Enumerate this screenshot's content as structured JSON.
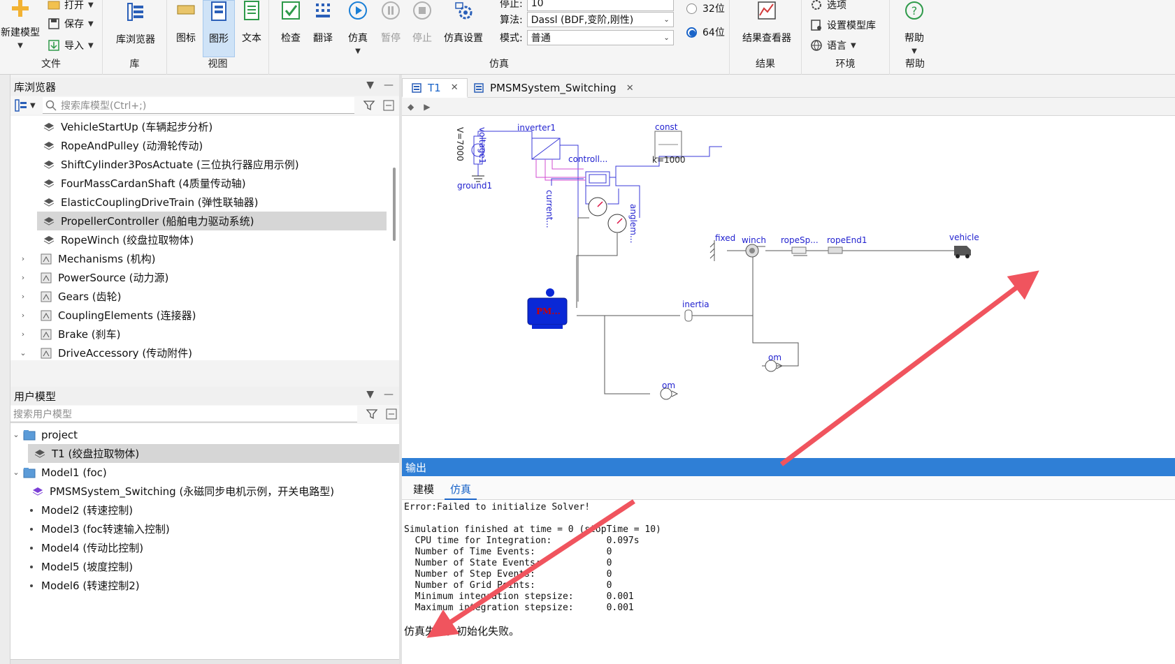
{
  "ribbon": {
    "file_group": {
      "new_model": "新建模型",
      "open": "打开",
      "save": "保存",
      "import": "导入",
      "label": "文件"
    },
    "lib_group": {
      "lib_browser": "库浏览器",
      "label": "库"
    },
    "view_group": {
      "icon": "图标",
      "diagram": "图形",
      "text": "文本",
      "label": "视图"
    },
    "sim_group": {
      "check": "检查",
      "translate": "翻译",
      "simulate": "仿真",
      "pause": "暂停",
      "stop": "停止",
      "sim_settings": "仿真设置",
      "stop_time_label": "停止:",
      "stop_time_value": "10",
      "algorithm_label": "算法:",
      "algorithm_value": "Dassl (BDF,变阶,刚性)",
      "mode_label": "模式:",
      "mode_value": "普通",
      "bit32": "32位",
      "bit64": "64位",
      "selected_bits": "64位",
      "label": "仿真"
    },
    "result_group": {
      "viewer": "结果查看器",
      "label": "结果"
    },
    "env_group": {
      "options": "选项",
      "set_model_lib": "设置模型库",
      "language": "语言",
      "label": "环境"
    },
    "help_group": {
      "help": "帮助",
      "label": "帮助"
    }
  },
  "lib_panel": {
    "title": "库浏览器",
    "search_placeholder": "搜索库模型(Ctrl+;)",
    "items": [
      {
        "label": "VehicleStartUp (车辆起步分析)",
        "type": "model"
      },
      {
        "label": "RopeAndPulley (动滑轮传动)",
        "type": "model"
      },
      {
        "label": "ShiftCylinder3PosActuate (三位执行器应用示例)",
        "type": "model"
      },
      {
        "label": "FourMassCardanShaft (4质量传动轴)",
        "type": "model"
      },
      {
        "label": "ElasticCouplingDriveTrain (弹性联轴器)",
        "type": "model"
      },
      {
        "label": "PropellerController (船舶电力驱动系统)",
        "type": "model",
        "selected": true
      },
      {
        "label": "RopeWinch (绞盘拉取物体)",
        "type": "model"
      },
      {
        "label": "Mechanisms (机构)",
        "type": "package"
      },
      {
        "label": "PowerSource (动力源)",
        "type": "package"
      },
      {
        "label": "Gears (齿轮)",
        "type": "package"
      },
      {
        "label": "CouplingElements (连接器)",
        "type": "package"
      },
      {
        "label": "Brake (刹车)",
        "type": "package"
      },
      {
        "label": "DriveAccessory (传动附件)",
        "type": "package",
        "expanded": true
      }
    ]
  },
  "user_panel": {
    "title": "用户模型",
    "search_placeholder": "搜索用户模型",
    "items": [
      {
        "label": "project",
        "type": "folder",
        "level": 0
      },
      {
        "label": "T1 (绞盘拉取物体)",
        "type": "model",
        "level": 1,
        "selected": true
      },
      {
        "label": "Model1 (foc)",
        "type": "folder",
        "level": 0
      },
      {
        "label": "PMSMSystem_Switching (永磁同步电机示例，开关电路型)",
        "type": "model-purple",
        "level": 1
      },
      {
        "label": "Model2 (转速控制)",
        "type": "leaf",
        "level": 1
      },
      {
        "label": "Model3 (foc转速输入控制)",
        "type": "leaf",
        "level": 1
      },
      {
        "label": "Model4 (传动比控制)",
        "type": "leaf",
        "level": 1
      },
      {
        "label": "Model5 (坡度控制)",
        "type": "leaf",
        "level": 1
      },
      {
        "label": "Model6 (转速控制2)",
        "type": "leaf",
        "level": 1
      }
    ]
  },
  "editor": {
    "tabs": [
      {
        "label": "T1",
        "active": true
      },
      {
        "label": "PMSMSystem_Switching",
        "active": false
      }
    ],
    "diagram": {
      "voltage_param": "V=7000",
      "voltage": "voltage1",
      "ground": "ground1",
      "inverter": "inverter1",
      "controller": "controll...",
      "const": "const",
      "const_param": "k=1000",
      "current": "current...",
      "angle": "anglem...",
      "motor": "PM...",
      "inertia": "inertia",
      "fixed": "fixed",
      "winch": "winch",
      "rope_spring": "ropeSp...",
      "rope_end": "ropeEnd1",
      "vehicle": "vehicle",
      "om1": "om",
      "om2": "om"
    }
  },
  "output": {
    "title": "输出",
    "tabs": [
      "建模",
      "仿真"
    ],
    "active_tab": "仿真",
    "lines": [
      "Error:Failed to initialize Solver!",
      "",
      "Simulation finished at time = 0 (stopTime = 10)",
      "  CPU time for Integration:          0.097s",
      "  Number of Time Events:             0",
      "  Number of State Events:            0",
      "  Number of Step Events:             0",
      "  Number of Grid Points:             0",
      "  Minimum integration stepsize:      0.001",
      "  Maximum integration stepsize:      0.001"
    ],
    "fail_message": "仿真失败。初始化失败。"
  },
  "colors": {
    "accent": "#2f7fd6",
    "diagram_blue": "#1f1fcf",
    "annotation_arrow": "#f0545e",
    "selection": "#d6d6d6"
  }
}
